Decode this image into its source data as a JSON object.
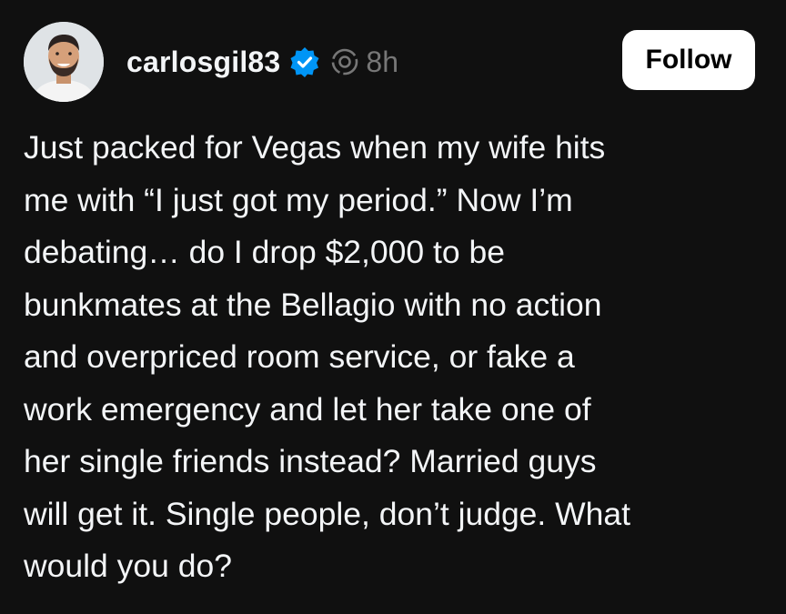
{
  "post": {
    "author": {
      "username": "carlosgil83",
      "verified": true,
      "avatar_icon": "person-avatar-icon"
    },
    "timestamp": "8h",
    "follow_label": "Follow",
    "text_lines": [
      "Just packed for Vegas when my wife hits",
      "me with “I just got my period.” Now I’m",
      "debating… do I drop $2,000 to be",
      "bunkmates at the Bellagio with no action",
      "and overpriced room service, or fake a",
      "work emergency and let her take one of",
      "her single friends instead? Married guys",
      "will get it. Single people, don’t judge. What",
      "would you do?"
    ]
  },
  "colors": {
    "background": "#101010",
    "text": "#f3f5f7",
    "muted": "#777777",
    "verified_badge": "#0095f6",
    "button_bg": "#ffffff",
    "button_text": "#000000"
  }
}
